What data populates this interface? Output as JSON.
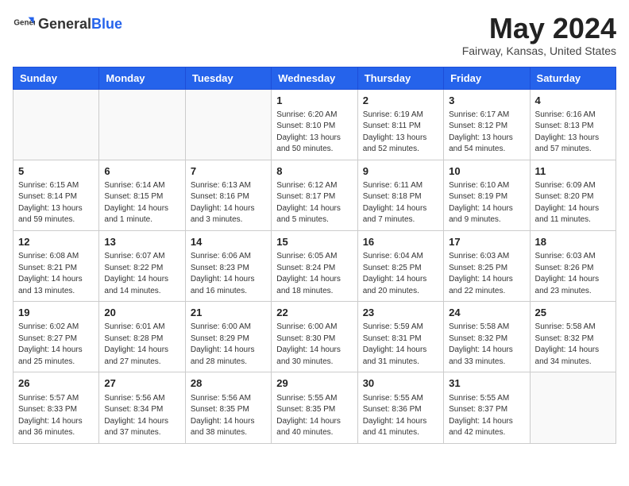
{
  "header": {
    "logo_general": "General",
    "logo_blue": "Blue",
    "month": "May 2024",
    "location": "Fairway, Kansas, United States"
  },
  "weekdays": [
    "Sunday",
    "Monday",
    "Tuesday",
    "Wednesday",
    "Thursday",
    "Friday",
    "Saturday"
  ],
  "weeks": [
    [
      {
        "day": "",
        "info": ""
      },
      {
        "day": "",
        "info": ""
      },
      {
        "day": "",
        "info": ""
      },
      {
        "day": "1",
        "info": "Sunrise: 6:20 AM\nSunset: 8:10 PM\nDaylight: 13 hours\nand 50 minutes."
      },
      {
        "day": "2",
        "info": "Sunrise: 6:19 AM\nSunset: 8:11 PM\nDaylight: 13 hours\nand 52 minutes."
      },
      {
        "day": "3",
        "info": "Sunrise: 6:17 AM\nSunset: 8:12 PM\nDaylight: 13 hours\nand 54 minutes."
      },
      {
        "day": "4",
        "info": "Sunrise: 6:16 AM\nSunset: 8:13 PM\nDaylight: 13 hours\nand 57 minutes."
      }
    ],
    [
      {
        "day": "5",
        "info": "Sunrise: 6:15 AM\nSunset: 8:14 PM\nDaylight: 13 hours\nand 59 minutes."
      },
      {
        "day": "6",
        "info": "Sunrise: 6:14 AM\nSunset: 8:15 PM\nDaylight: 14 hours\nand 1 minute."
      },
      {
        "day": "7",
        "info": "Sunrise: 6:13 AM\nSunset: 8:16 PM\nDaylight: 14 hours\nand 3 minutes."
      },
      {
        "day": "8",
        "info": "Sunrise: 6:12 AM\nSunset: 8:17 PM\nDaylight: 14 hours\nand 5 minutes."
      },
      {
        "day": "9",
        "info": "Sunrise: 6:11 AM\nSunset: 8:18 PM\nDaylight: 14 hours\nand 7 minutes."
      },
      {
        "day": "10",
        "info": "Sunrise: 6:10 AM\nSunset: 8:19 PM\nDaylight: 14 hours\nand 9 minutes."
      },
      {
        "day": "11",
        "info": "Sunrise: 6:09 AM\nSunset: 8:20 PM\nDaylight: 14 hours\nand 11 minutes."
      }
    ],
    [
      {
        "day": "12",
        "info": "Sunrise: 6:08 AM\nSunset: 8:21 PM\nDaylight: 14 hours\nand 13 minutes."
      },
      {
        "day": "13",
        "info": "Sunrise: 6:07 AM\nSunset: 8:22 PM\nDaylight: 14 hours\nand 14 minutes."
      },
      {
        "day": "14",
        "info": "Sunrise: 6:06 AM\nSunset: 8:23 PM\nDaylight: 14 hours\nand 16 minutes."
      },
      {
        "day": "15",
        "info": "Sunrise: 6:05 AM\nSunset: 8:24 PM\nDaylight: 14 hours\nand 18 minutes."
      },
      {
        "day": "16",
        "info": "Sunrise: 6:04 AM\nSunset: 8:25 PM\nDaylight: 14 hours\nand 20 minutes."
      },
      {
        "day": "17",
        "info": "Sunrise: 6:03 AM\nSunset: 8:25 PM\nDaylight: 14 hours\nand 22 minutes."
      },
      {
        "day": "18",
        "info": "Sunrise: 6:03 AM\nSunset: 8:26 PM\nDaylight: 14 hours\nand 23 minutes."
      }
    ],
    [
      {
        "day": "19",
        "info": "Sunrise: 6:02 AM\nSunset: 8:27 PM\nDaylight: 14 hours\nand 25 minutes."
      },
      {
        "day": "20",
        "info": "Sunrise: 6:01 AM\nSunset: 8:28 PM\nDaylight: 14 hours\nand 27 minutes."
      },
      {
        "day": "21",
        "info": "Sunrise: 6:00 AM\nSunset: 8:29 PM\nDaylight: 14 hours\nand 28 minutes."
      },
      {
        "day": "22",
        "info": "Sunrise: 6:00 AM\nSunset: 8:30 PM\nDaylight: 14 hours\nand 30 minutes."
      },
      {
        "day": "23",
        "info": "Sunrise: 5:59 AM\nSunset: 8:31 PM\nDaylight: 14 hours\nand 31 minutes."
      },
      {
        "day": "24",
        "info": "Sunrise: 5:58 AM\nSunset: 8:32 PM\nDaylight: 14 hours\nand 33 minutes."
      },
      {
        "day": "25",
        "info": "Sunrise: 5:58 AM\nSunset: 8:32 PM\nDaylight: 14 hours\nand 34 minutes."
      }
    ],
    [
      {
        "day": "26",
        "info": "Sunrise: 5:57 AM\nSunset: 8:33 PM\nDaylight: 14 hours\nand 36 minutes."
      },
      {
        "day": "27",
        "info": "Sunrise: 5:56 AM\nSunset: 8:34 PM\nDaylight: 14 hours\nand 37 minutes."
      },
      {
        "day": "28",
        "info": "Sunrise: 5:56 AM\nSunset: 8:35 PM\nDaylight: 14 hours\nand 38 minutes."
      },
      {
        "day": "29",
        "info": "Sunrise: 5:55 AM\nSunset: 8:35 PM\nDaylight: 14 hours\nand 40 minutes."
      },
      {
        "day": "30",
        "info": "Sunrise: 5:55 AM\nSunset: 8:36 PM\nDaylight: 14 hours\nand 41 minutes."
      },
      {
        "day": "31",
        "info": "Sunrise: 5:55 AM\nSunset: 8:37 PM\nDaylight: 14 hours\nand 42 minutes."
      },
      {
        "day": "",
        "info": ""
      }
    ]
  ]
}
